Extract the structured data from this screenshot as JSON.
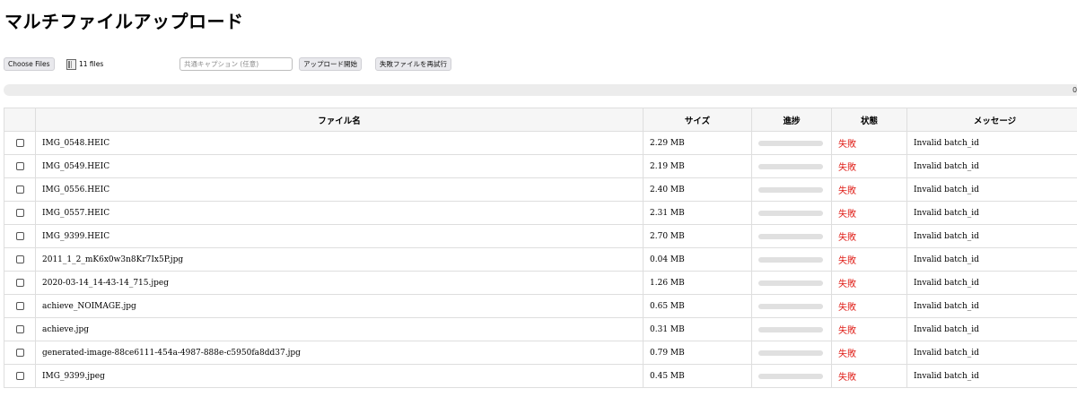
{
  "page": {
    "title": "マルチファイルアップロード"
  },
  "toolbar": {
    "choose_files_label": "Choose Files",
    "files_count": "11 files",
    "caption_placeholder": "共通キャプション (任意)",
    "upload_start_label": "アップロード開始",
    "retry_failed_label": "失敗ファイルを再試行"
  },
  "overall_progress": {
    "value_text": "0",
    "fraction": 0
  },
  "table": {
    "headers": {
      "filename": "ファイル名",
      "size": "サイズ",
      "progress": "進捗",
      "status": "状態",
      "message": "メッセージ"
    },
    "rows": [
      {
        "filename": "IMG_0548.HEIC",
        "size": "2.29 MB",
        "progress": 0,
        "status": "失敗",
        "message": "Invalid batch_id"
      },
      {
        "filename": "IMG_0549.HEIC",
        "size": "2.19 MB",
        "progress": 0,
        "status": "失敗",
        "message": "Invalid batch_id"
      },
      {
        "filename": "IMG_0556.HEIC",
        "size": "2.40 MB",
        "progress": 0,
        "status": "失敗",
        "message": "Invalid batch_id"
      },
      {
        "filename": "IMG_0557.HEIC",
        "size": "2.31 MB",
        "progress": 0,
        "status": "失敗",
        "message": "Invalid batch_id"
      },
      {
        "filename": "IMG_9399.HEIC",
        "size": "2.70 MB",
        "progress": 0,
        "status": "失敗",
        "message": "Invalid batch_id"
      },
      {
        "filename": "2011_1_2_mK6x0w3n8Kr7Ix5P.jpg",
        "size": "0.04 MB",
        "progress": 0,
        "status": "失敗",
        "message": "Invalid batch_id"
      },
      {
        "filename": "2020-03-14_14-43-14_715.jpeg",
        "size": "1.26 MB",
        "progress": 0,
        "status": "失敗",
        "message": "Invalid batch_id"
      },
      {
        "filename": "achieve_NOIMAGE.jpg",
        "size": "0.65 MB",
        "progress": 0,
        "status": "失敗",
        "message": "Invalid batch_id"
      },
      {
        "filename": "achieve.jpg",
        "size": "0.31 MB",
        "progress": 0,
        "status": "失敗",
        "message": "Invalid batch_id"
      },
      {
        "filename": "generated-image-88ce6111-454a-4987-888e-c5950fa8dd37.jpg",
        "size": "0.79 MB",
        "progress": 0,
        "status": "失敗",
        "message": "Invalid batch_id"
      },
      {
        "filename": "IMG_9399.jpeg",
        "size": "0.45 MB",
        "progress": 0,
        "status": "失敗",
        "message": "Invalid batch_id"
      }
    ]
  },
  "colors": {
    "status_failed": "#e0201a",
    "progress_track": "#e0e0e0",
    "progress_fill": "#4caf50"
  }
}
